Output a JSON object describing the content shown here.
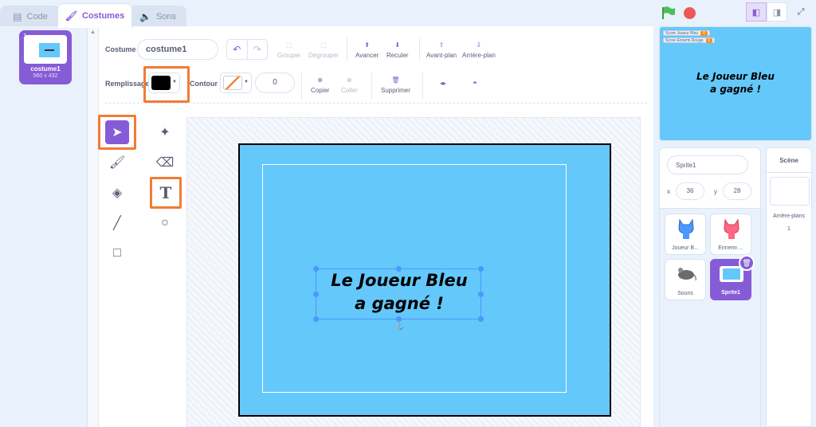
{
  "tabs": [
    {
      "label": "Code",
      "icon": "code-icon"
    },
    {
      "label": "Costumes",
      "icon": "brush-icon"
    },
    {
      "label": "Sons",
      "icon": "speaker-icon"
    }
  ],
  "costume_list": [
    {
      "index": "1",
      "name": "costume1",
      "size": "560 x 432"
    }
  ],
  "toolbar": {
    "costume_label": "Costume",
    "costume_name": "costume1",
    "fill_label": "Remplissage",
    "outline_label": "Contour",
    "outline_width": "0",
    "fill_color": "#000000",
    "outline_color": "#f0863c",
    "buttons": {
      "group": "Grouper",
      "ungroup": "Dégrouper",
      "forward": "Avancer",
      "backward": "Reculer",
      "front": "Avant-plan",
      "back": "Arrière-plan",
      "copy": "Copier",
      "paste": "Coller",
      "delete": "Supprimer"
    }
  },
  "canvas": {
    "text_line1": "Le Joueur Bleu",
    "text_line2": "a gagné !",
    "background_color": "#64c8fa"
  },
  "stage": {
    "monitors": [
      {
        "label": "Score Joueur Bleu",
        "value": "0"
      },
      {
        "label": "Score Ennemi Rouge",
        "value": "0"
      }
    ],
    "text_line1": "Le Joueur Bleu",
    "text_line2": "a gagné !"
  },
  "sprite_info": {
    "name": "Sprite1",
    "x_label": "x",
    "x": "36",
    "y_label": "y",
    "y": "28"
  },
  "sprites": [
    {
      "name": "Joueur B...",
      "icon": "blue-cat-icon"
    },
    {
      "name": "Ennemi ...",
      "icon": "red-cat-icon"
    },
    {
      "name": "Souris",
      "icon": "mouse-icon"
    },
    {
      "name": "Sprite1",
      "icon": "sprite1-thumbnail"
    }
  ],
  "scene": {
    "title": "Scène",
    "backdrops_label": "Arrière-plans",
    "backdrops_count": "1"
  },
  "colors": {
    "accent": "#855cd6",
    "highlight": "#f27b35"
  }
}
